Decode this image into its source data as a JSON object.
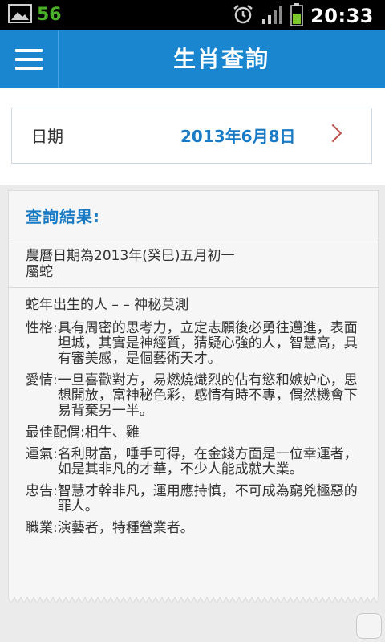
{
  "status_bar": {
    "notification_count": "56",
    "time": "20:33",
    "icons": [
      "image-icon",
      "alarm-icon",
      "signal-icon",
      "battery-icon"
    ]
  },
  "app_bar": {
    "title": "生肖查詢",
    "menu_icon": "hamburger-menu-icon"
  },
  "date_picker": {
    "label": "日期",
    "value": "2013年6月8日",
    "arrow_icon": "chevron-right-icon"
  },
  "result": {
    "heading": "查詢結果:",
    "lunar_date": "農曆日期為2013年(癸巳)五月初一",
    "zodiac": "屬蛇",
    "headline": "蛇年出生的人 – – 神秘莫測",
    "sections": [
      {
        "label": "性格:",
        "text": "具有周密的思考力，立定志願後必勇往邁進，表面坦城，其實是神經質，猜疑心強的人，智慧高，具有審美感，是個藝術天才。"
      },
      {
        "label": "愛情:",
        "text": "一旦喜歡對方，易燃燒熾烈的佔有慾和嫉妒心，思想開放，富神秘色彩，感情有時不專，偶然機會下易背棄另一半。"
      },
      {
        "label": "最佳配偶:",
        "text": "相牛、雞"
      },
      {
        "label": "運氣:",
        "text": "名利財富，唾手可得，在金錢方面是一位幸運者，如是其非凡的才華，不少人能成就大業。"
      },
      {
        "label": "忠告:",
        "text": "智慧才幹非凡，運用應持慎，不可成為窮兇極惡的罪人。"
      },
      {
        "label": "職業:",
        "text": "演藝者，特種營業者。"
      }
    ]
  },
  "colors": {
    "app_bar": "#1a86d0",
    "accent_text": "#1a7bc4",
    "arrow": "#c0504d",
    "status_green": "#4caf2a"
  }
}
